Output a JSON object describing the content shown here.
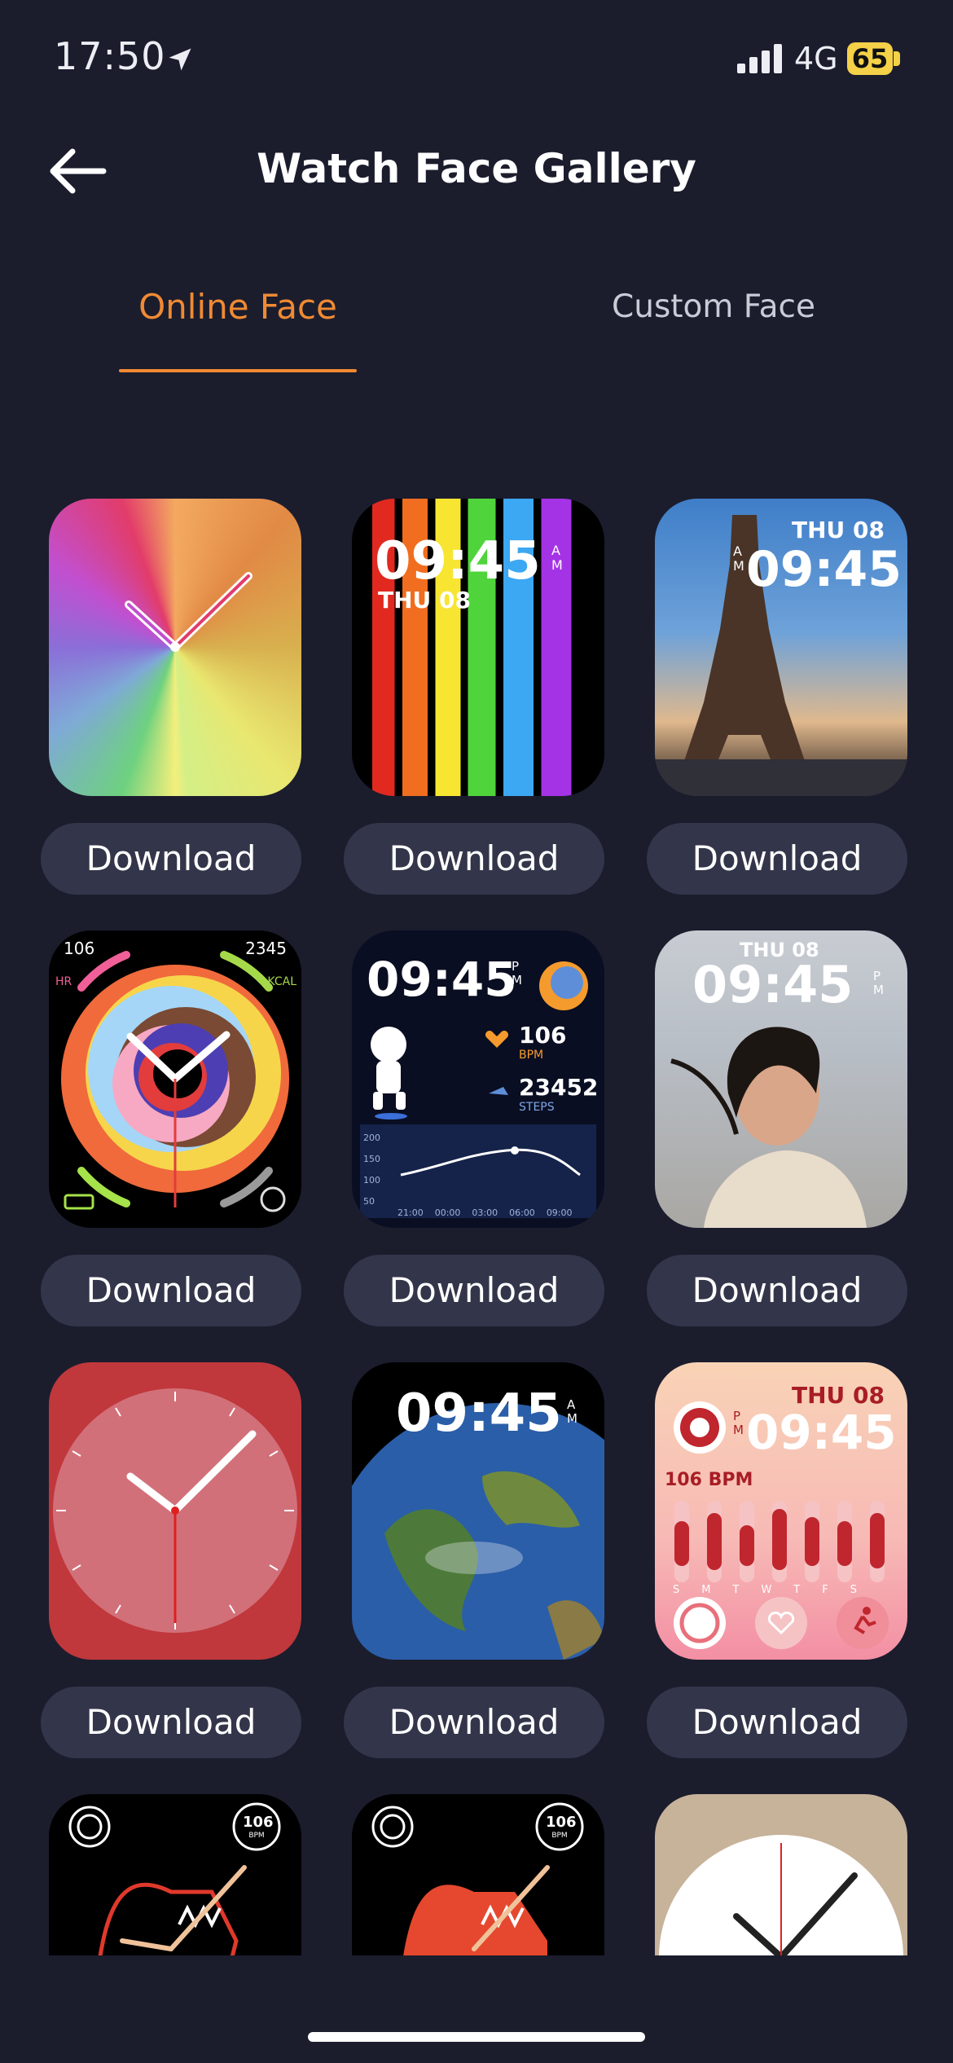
{
  "status_bar": {
    "time": "17:50",
    "network": "4G",
    "battery": "65"
  },
  "header": {
    "title": "Watch Face Gallery"
  },
  "tabs": [
    {
      "label": "Online Face",
      "active": true
    },
    {
      "label": "Custom Face",
      "active": false
    }
  ],
  "faces": [
    {
      "style": "color-wheel",
      "button": "Download"
    },
    {
      "style": "rainbow-stripes",
      "time": "09:45",
      "ampm": "AM",
      "date": "THU 08",
      "button": "Download"
    },
    {
      "style": "eiffel-tower",
      "time": "09:45",
      "ampm": "AM",
      "date": "THU 08",
      "button": "Download"
    },
    {
      "style": "spiral-activity",
      "left_value": "106",
      "right_value": "2345",
      "left_tag": "HR",
      "right_tag": "KCAL",
      "button": "Download"
    },
    {
      "style": "astronaut-dashboard",
      "time": "09:45",
      "ampm": "PM",
      "heart": "106",
      "heart_unit": "BPM",
      "steps": "23452",
      "steps_unit": "STEPS",
      "y_ticks": [
        "200",
        "150",
        "100",
        "50"
      ],
      "x_ticks": [
        "21:00",
        "00:00",
        "03:00",
        "06:00",
        "09:00"
      ],
      "button": "Download"
    },
    {
      "style": "portrait-photo",
      "time": "09:45",
      "ampm": "PM",
      "date": "THU 08",
      "button": "Download"
    },
    {
      "style": "red-analog",
      "button": "Download"
    },
    {
      "style": "earth",
      "time": "09:45",
      "ampm": "AM",
      "button": "Download"
    },
    {
      "style": "pink-activity",
      "date": "THU 08",
      "time": "09:45",
      "ampm": "PM",
      "heart": "106 BPM",
      "days": [
        "S",
        "M",
        "T",
        "W",
        "T",
        "F",
        "S"
      ],
      "button": "Download"
    },
    {
      "style": "horse-black",
      "bpm": "106",
      "bpm_unit": "BPM"
    },
    {
      "style": "horse-red",
      "bpm": "106",
      "bpm_unit": "BPM"
    },
    {
      "style": "classic-analog"
    }
  ],
  "colors": {
    "background": "#1b1d2d",
    "accent": "#f08a33",
    "button_bg": "#33364a"
  }
}
